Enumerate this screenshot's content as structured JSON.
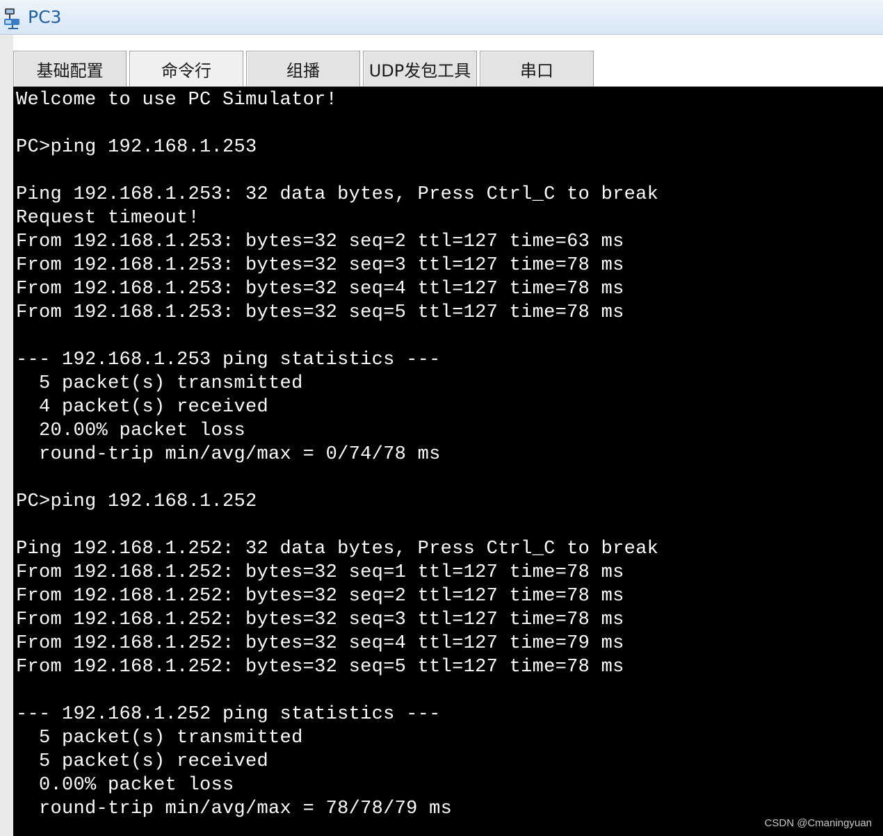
{
  "window": {
    "title": "PC3",
    "icon": "pc-network-icon"
  },
  "tabs": [
    {
      "label": "基础配置",
      "active": false
    },
    {
      "label": "命令行",
      "active": true
    },
    {
      "label": "组播",
      "active": false
    },
    {
      "label": "UDP发包工具",
      "active": false
    },
    {
      "label": "串口",
      "active": false
    }
  ],
  "terminal": {
    "lines": [
      "Welcome to use PC Simulator!",
      "",
      "PC>ping 192.168.1.253",
      "",
      "Ping 192.168.1.253: 32 data bytes, Press Ctrl_C to break",
      "Request timeout!",
      "From 192.168.1.253: bytes=32 seq=2 ttl=127 time=63 ms",
      "From 192.168.1.253: bytes=32 seq=3 ttl=127 time=78 ms",
      "From 192.168.1.253: bytes=32 seq=4 ttl=127 time=78 ms",
      "From 192.168.1.253: bytes=32 seq=5 ttl=127 time=78 ms",
      "",
      "--- 192.168.1.253 ping statistics ---",
      "  5 packet(s) transmitted",
      "  4 packet(s) received",
      "  20.00% packet loss",
      "  round-trip min/avg/max = 0/74/78 ms",
      "",
      "PC>ping 192.168.1.252",
      "",
      "Ping 192.168.1.252: 32 data bytes, Press Ctrl_C to break",
      "From 192.168.1.252: bytes=32 seq=1 ttl=127 time=78 ms",
      "From 192.168.1.252: bytes=32 seq=2 ttl=127 time=78 ms",
      "From 192.168.1.252: bytes=32 seq=3 ttl=127 time=78 ms",
      "From 192.168.1.252: bytes=32 seq=4 ttl=127 time=79 ms",
      "From 192.168.1.252: bytes=32 seq=5 ttl=127 time=78 ms",
      "",
      "--- 192.168.1.252 ping statistics ---",
      "  5 packet(s) transmitted",
      "  5 packet(s) received",
      "  0.00% packet loss",
      "  round-trip min/avg/max = 78/78/79 ms"
    ]
  },
  "watermark": "CSDN @Cmaningyuan"
}
